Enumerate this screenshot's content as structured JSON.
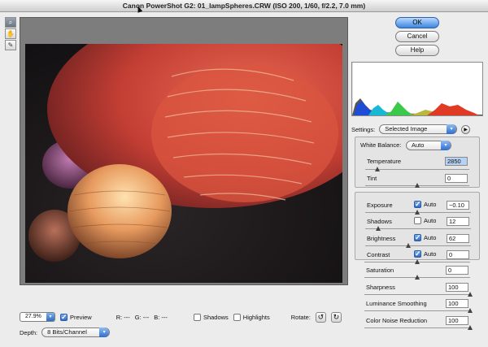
{
  "window": {
    "title": "Canon PowerShot G2:  01_lampSpheres.CRW  (ISO 200, 1/60, f/2.2, 7.0 mm)"
  },
  "tools": [
    {
      "name": "zoom-tool-icon",
      "glyph": "🔍"
    },
    {
      "name": "hand-tool-icon",
      "glyph": "✋"
    },
    {
      "name": "eyedropper-tool-icon",
      "glyph": "✎"
    }
  ],
  "buttons": {
    "ok": "OK",
    "cancel": "Cancel",
    "help": "Help"
  },
  "statusbar": {
    "zoom": "27.9%",
    "preview_label": "Preview",
    "preview_checked": true,
    "r": "R:  ---",
    "g": "G:  ---",
    "b": "B:  ---",
    "shadows_label": "Shadows",
    "highlights_label": "Highlights",
    "rotate_label": "Rotate:"
  },
  "depth": {
    "label": "Depth:",
    "value": "8 Bits/Channel"
  },
  "settings": {
    "label": "Settings:",
    "value": "Selected Image"
  },
  "white_balance": {
    "label": "White Balance:",
    "value": "Auto"
  },
  "controls": {
    "temperature": {
      "label": "Temperature",
      "value": "2850",
      "level": 0.12
    },
    "tint": {
      "label": "Tint",
      "value": "0",
      "level": 0.5
    },
    "exposure": {
      "label": "Exposure",
      "value": "−0.10",
      "auto": true,
      "auto_label": "Auto",
      "level": 0.49
    },
    "shadows": {
      "label": "Shadows",
      "value": "12",
      "auto": false,
      "auto_label": "Auto",
      "level": 0.12
    },
    "brightness": {
      "label": "Brightness",
      "value": "62",
      "auto": true,
      "auto_label": "Auto",
      "level": 0.41
    },
    "contrast": {
      "label": "Contrast",
      "value": "0",
      "auto": true,
      "auto_label": "Auto",
      "level": 0.5
    },
    "saturation": {
      "label": "Saturation",
      "value": "0",
      "level": 0.5
    },
    "sharpness": {
      "label": "Sharpness",
      "value": "100",
      "level": 1.0
    },
    "luminance_smoothing": {
      "label": "Luminance Smoothing",
      "value": "100",
      "level": 1.0
    },
    "color_noise_reduction": {
      "label": "Color Noise Reduction",
      "value": "100",
      "level": 1.0
    }
  },
  "colors": {
    "accent": "#3c86e0",
    "photo_bg": "#1c1a1c",
    "preview_bg": "#7d7d7d"
  }
}
